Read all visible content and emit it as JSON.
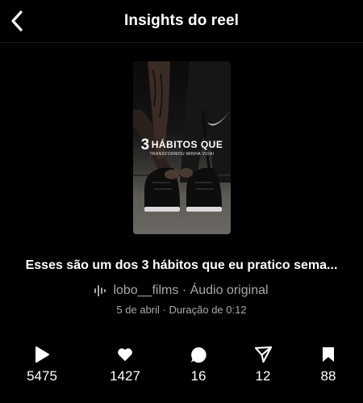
{
  "header": {
    "title": "Insights do reel"
  },
  "reel": {
    "overlay_number": "3",
    "overlay_line1": "HÁBITOS QUE",
    "overlay_line2": "TRANSFORMOU MINHA VIDA!",
    "caption": "Esses são um dos 3 hábitos que eu pratico sema...",
    "audio_text": "lobo__films · Áudio original",
    "meta_text": "5 de abril · Duração de 0:12"
  },
  "stats": {
    "plays": "5475",
    "likes": "1427",
    "comments": "16",
    "shares": "12",
    "saves": "88"
  },
  "icons": {
    "back": "chevron-left-icon",
    "audio": "audio-wave-icon",
    "plays": "play-icon",
    "likes": "heart-icon",
    "comments": "comment-bubble-icon",
    "shares": "paper-plane-icon",
    "saves": "bookmark-icon"
  },
  "colors": {
    "background": "#000000",
    "text": "#ffffff",
    "secondary_text": "#a8a8a8"
  }
}
